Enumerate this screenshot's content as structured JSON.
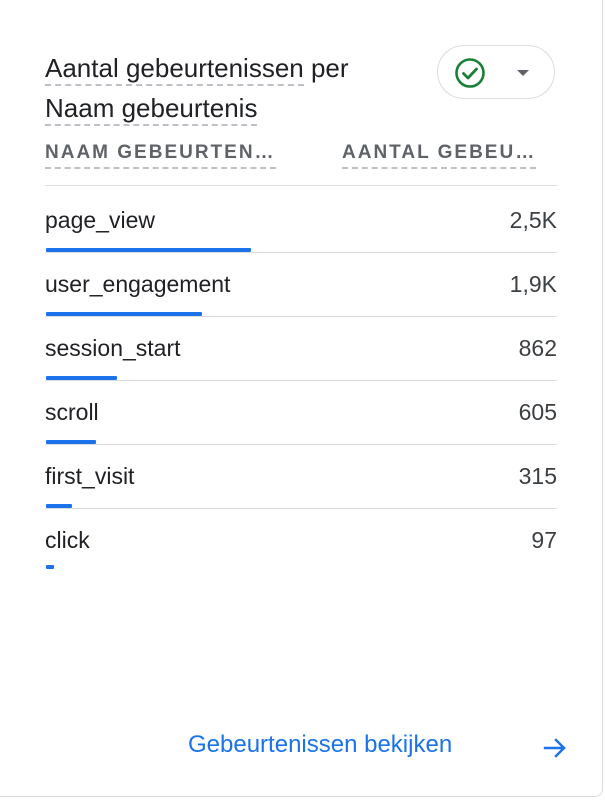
{
  "card": {
    "title_line1": "Aantal gebeurtenissen",
    "title_line1_suffix": " per",
    "title_line2": "Naam gebeurtenis",
    "status_icon": "check-circle-icon",
    "status_color": "#188038",
    "dropdown_icon": "caret-down-icon"
  },
  "table": {
    "columns": [
      "NAAM GEBEURTEN…",
      "AANTAL GEBEU…"
    ],
    "rows": [
      {
        "name": "page_view",
        "value": "2,5K",
        "count": 2500
      },
      {
        "name": "user_engagement",
        "value": "1,9K",
        "count": 1900
      },
      {
        "name": "session_start",
        "value": "862",
        "count": 862
      },
      {
        "name": "scroll",
        "value": "605",
        "count": 605
      },
      {
        "name": "first_visit",
        "value": "315",
        "count": 315
      },
      {
        "name": "click",
        "value": "97",
        "count": 97
      }
    ],
    "bar_color": "#1a73e8"
  },
  "footer": {
    "link_label": "Gebeurtenissen bekijken",
    "link_icon": "arrow-right-icon",
    "link_color": "#1a73e8"
  }
}
